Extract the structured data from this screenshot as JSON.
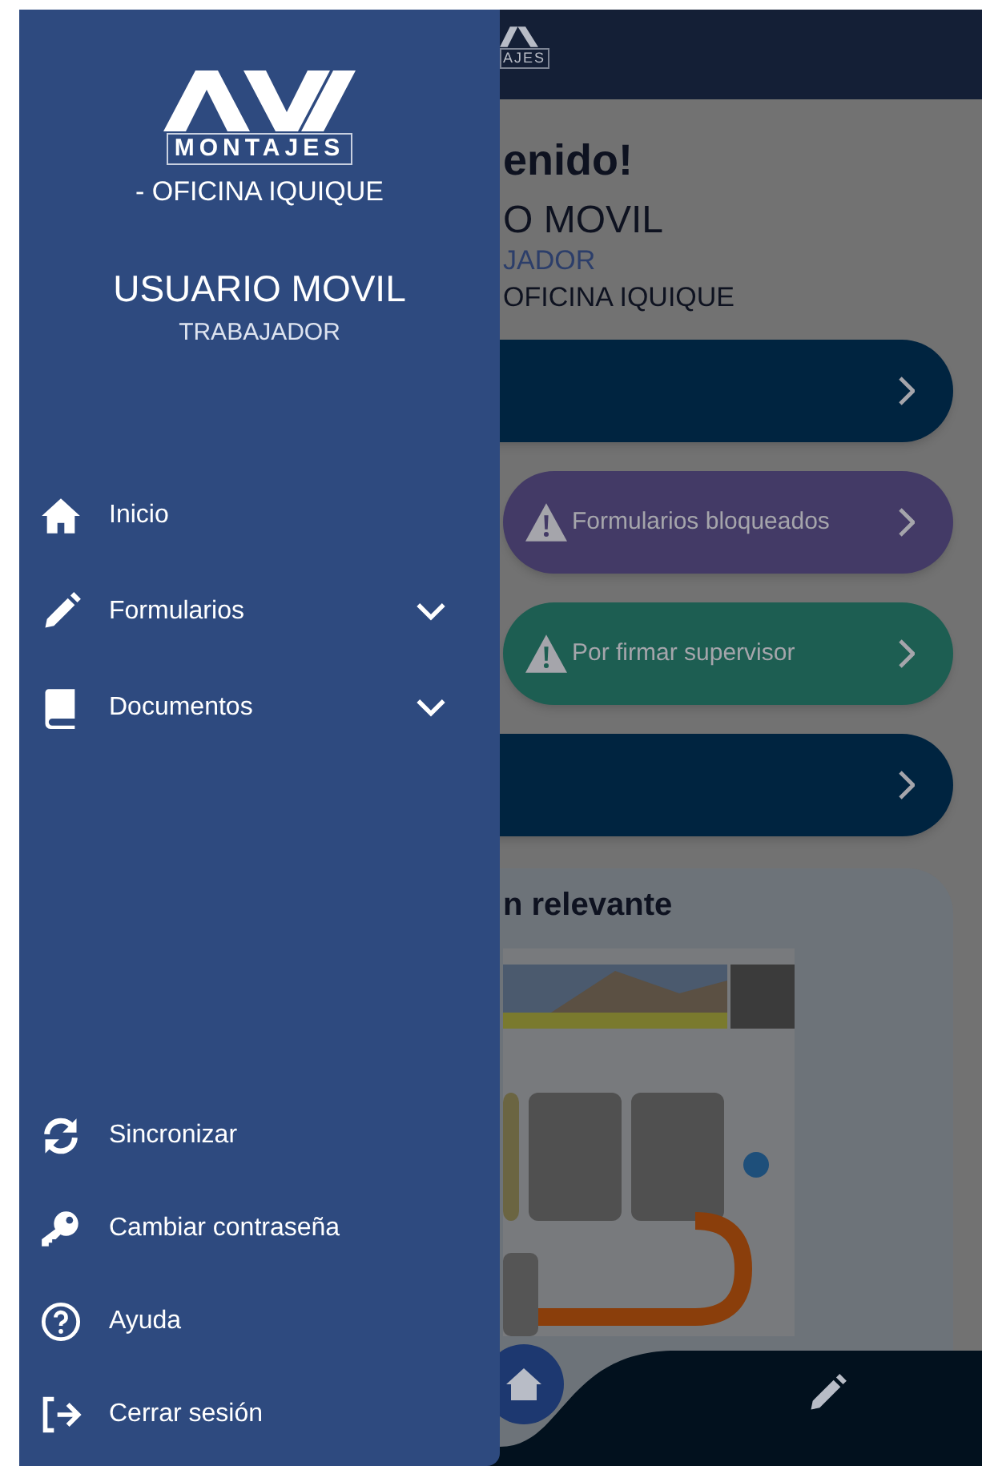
{
  "drawer": {
    "logo_caption": "MONTAJES",
    "office": "- OFICINA IQUIQUE",
    "user_name": "USUARIO MOVIL",
    "role": "TRABAJADOR",
    "menu": [
      {
        "kind": "link",
        "label": "Inicio"
      },
      {
        "kind": "group",
        "label": "Formularios",
        "expanded": false
      },
      {
        "kind": "group",
        "label": "Documentos",
        "expanded": false
      }
    ],
    "footer_menu": [
      {
        "label": "Sincronizar"
      },
      {
        "label": "Cambiar contraseña"
      },
      {
        "label": "Ayuda"
      },
      {
        "label": "Cerrar sesión"
      }
    ]
  },
  "background": {
    "header_logo_text": "AJES",
    "greeting": "enido!",
    "user_name": "O MOVIL",
    "role": "JADOR",
    "office": "OFICINA IQUIQUE",
    "actions": [
      {
        "kind": "plain",
        "color": "#002440"
      },
      {
        "kind": "warning",
        "color": "#433a66",
        "label": "Formularios bloqueados"
      },
      {
        "kind": "warning",
        "color": "#1d5e52",
        "label": "Por firmar supervisor"
      },
      {
        "kind": "plain",
        "color": "#002440"
      }
    ],
    "card": {
      "title": "n relevante"
    }
  }
}
